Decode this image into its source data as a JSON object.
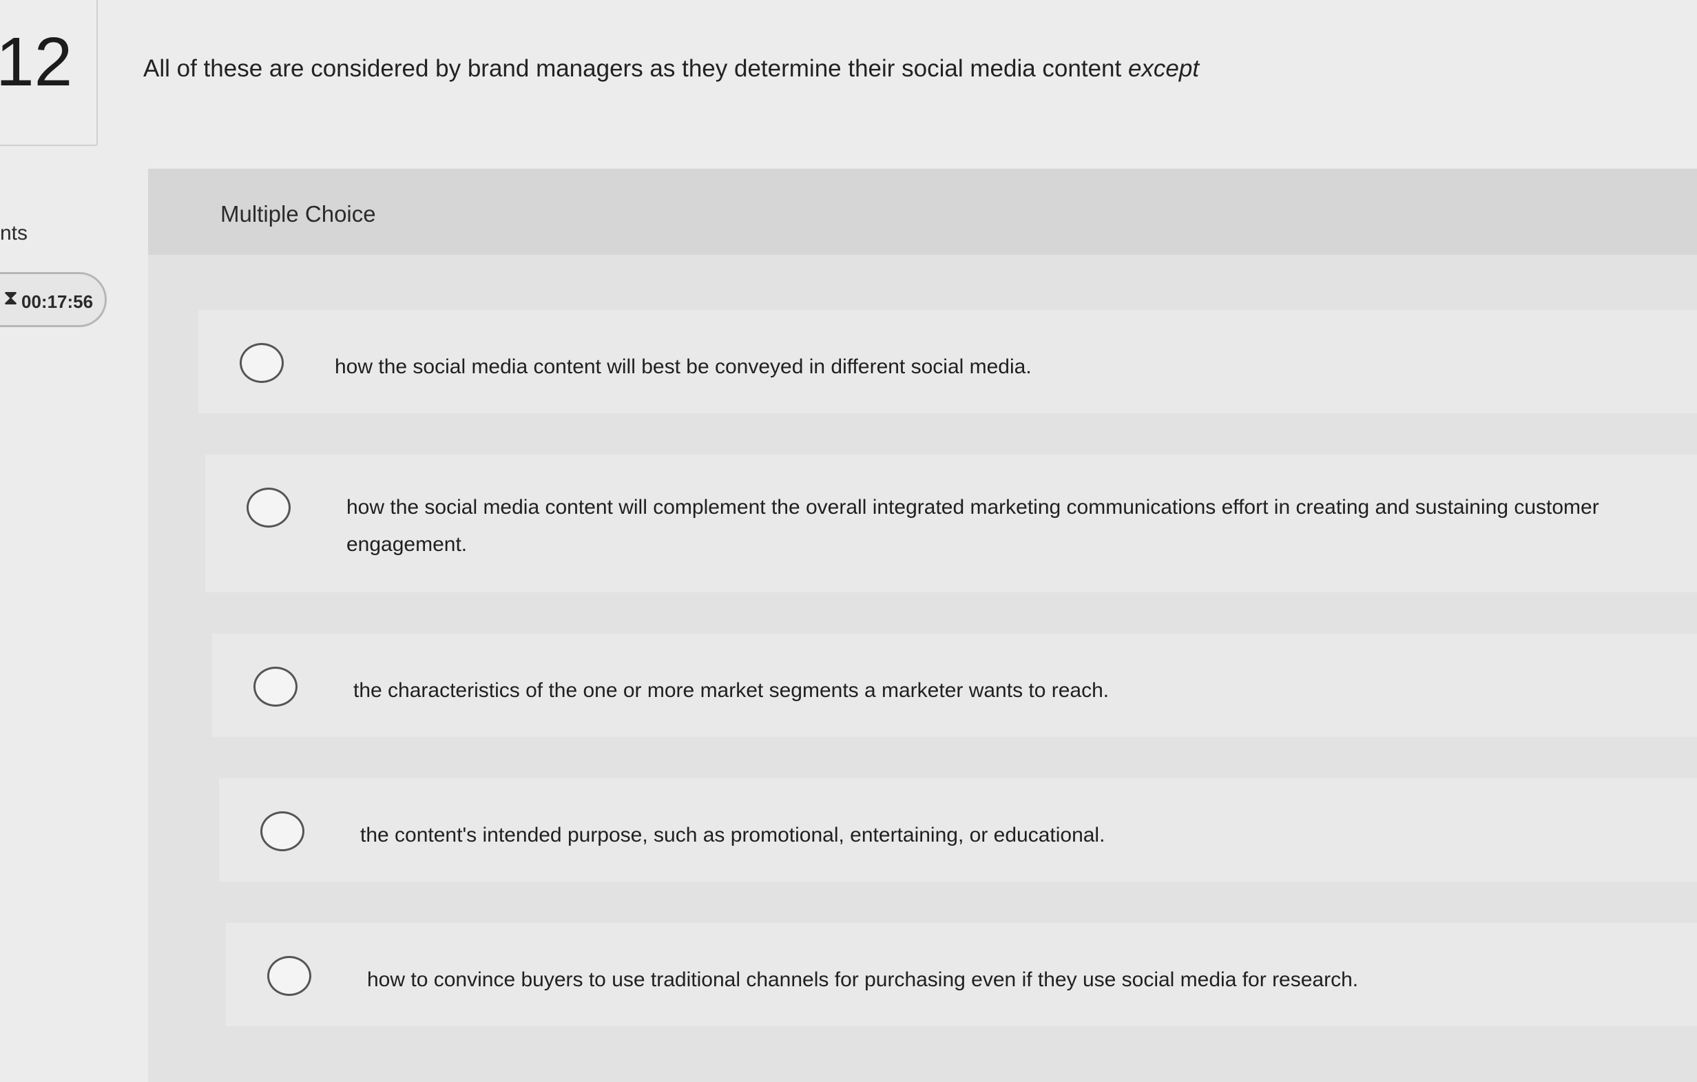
{
  "question": {
    "number": "12",
    "text": "All of these are considered by brand managers as they determine their social media content",
    "emphasis": "except"
  },
  "sidebar": {
    "points_label": "nts",
    "timer": "00:17:56",
    "timer_icon": "hourglass-icon"
  },
  "panel": {
    "type_label": "Multiple Choice"
  },
  "choices": [
    {
      "label": "how the social media content will best be conveyed in different social media."
    },
    {
      "label": "how the social media content will complement the overall integrated marketing communications effort in creating and sustaining customer engagement."
    },
    {
      "label": "the characteristics of the one or more market segments a marketer wants to reach."
    },
    {
      "label": "the content's intended purpose, such as promotional, entertaining, or educational."
    },
    {
      "label": "how to convince buyers to use traditional channels for purchasing even if they use social media for research."
    }
  ]
}
